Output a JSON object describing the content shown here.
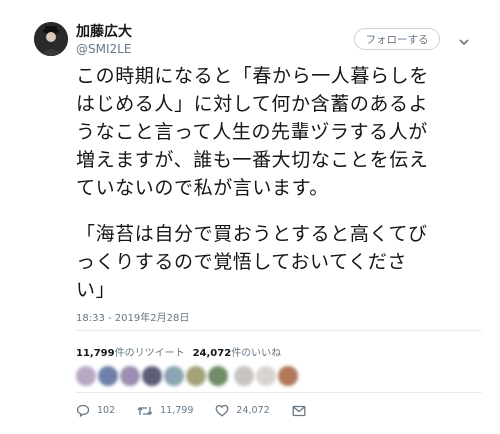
{
  "author": {
    "name": "加藤広大",
    "handle": "@SMI2LE"
  },
  "follow_button": {
    "label": "フォローする"
  },
  "tweet": {
    "paragraph1": "この時期になると「春から一人暮らしを\nはじめる人」に対して何か含蓄のあるよ\nうなこと言って人生の先輩ヅラする人が\n増えますが、誰も一番大切なことを伝え\nていないので私が言います。",
    "paragraph2": "「海苔は自分で買おうとすると高くてび\nっくりするので覚悟しておいてくださ\nい」",
    "timestamp": "18:33 - 2019年2月28日"
  },
  "stats": {
    "retweet_count": "11,799",
    "retweet_label": "件のリツイート",
    "like_count": "24,072",
    "like_label": "件のいいね"
  },
  "actions": {
    "reply_count": "102",
    "retweet_count": "11,799",
    "like_count": "24,072"
  },
  "liker_colors": [
    "#b9a8c4",
    "#6f7fa8",
    "#9a8fb0",
    "#5c5e7a",
    "#8aa4b2",
    "#a3a27a",
    "#6f8d6a",
    "#c8c4be",
    "#d8d5d0",
    "#b07a5c"
  ]
}
